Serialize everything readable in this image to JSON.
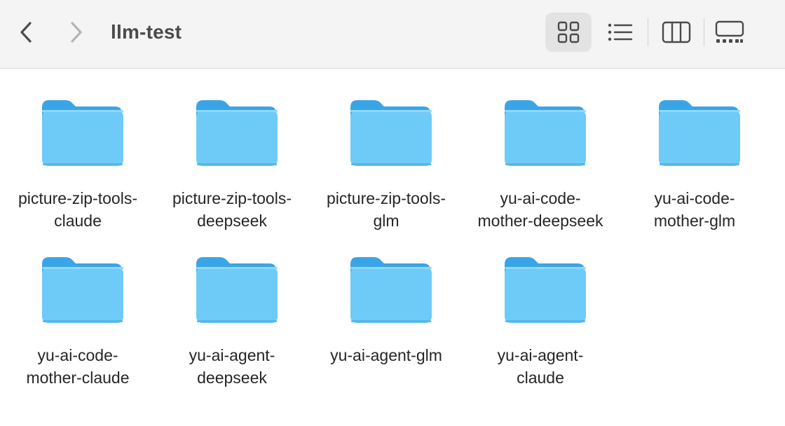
{
  "window": {
    "title": "llm-test"
  },
  "toolbar": {
    "back_icon": "chevron-left-icon",
    "forward_icon": "chevron-right-icon",
    "views": [
      {
        "name": "icon-view",
        "icon": "grid-icon",
        "selected": true
      },
      {
        "name": "list-view",
        "icon": "list-icon",
        "selected": false
      },
      {
        "name": "column-view",
        "icon": "columns-icon",
        "selected": false
      },
      {
        "name": "gallery-view",
        "icon": "gallery-icon",
        "selected": false
      }
    ]
  },
  "colors": {
    "folder_back": "#3aa5e6",
    "folder_front": "#6ecbf7",
    "selected_view_bg": "#e3e3e4",
    "toolbar_bg": "#f4f4f5"
  },
  "items": [
    {
      "line1": "picture-zip-tools-",
      "line2": "claude"
    },
    {
      "line1": "picture-zip-tools-",
      "line2": "deepseek"
    },
    {
      "line1": "picture-zip-tools-",
      "line2": "glm"
    },
    {
      "line1": "yu-ai-code-",
      "line2": "mother-deepseek"
    },
    {
      "line1": "yu-ai-code-",
      "line2": "mother-glm"
    },
    {
      "line1": "yu-ai-code-",
      "line2": "mother-claude"
    },
    {
      "line1": "yu-ai-agent-",
      "line2": "deepseek"
    },
    {
      "line1": "yu-ai-agent-glm",
      "line2": ""
    },
    {
      "line1": "yu-ai-agent-",
      "line2": "claude"
    }
  ]
}
